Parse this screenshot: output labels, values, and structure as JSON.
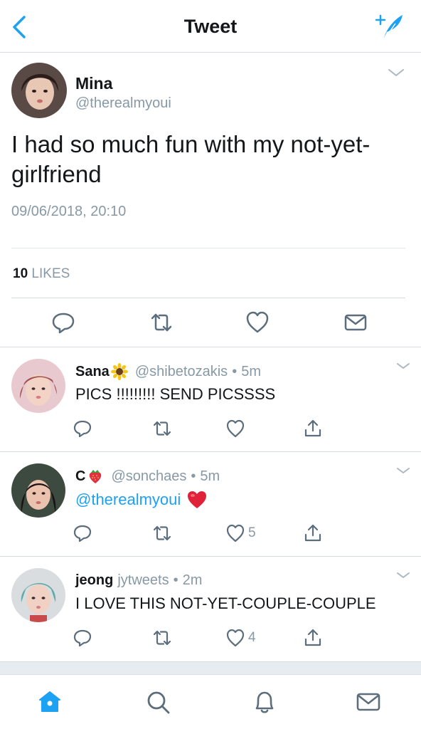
{
  "header": {
    "title": "Tweet",
    "back_icon": "chevron-left-icon",
    "compose_icon": "compose-feather-icon",
    "accent": "#1da1f2"
  },
  "tweet": {
    "author_name": "Mina",
    "author_handle": "@therealmyoui",
    "text": "I had so much fun with my not-yet-girlfriend",
    "date": "09/06/2018, 20:10",
    "likes_count": "10",
    "likes_label": "LIKES",
    "actions": [
      "reply-icon",
      "retweet-icon",
      "like-icon",
      "message-icon"
    ]
  },
  "replies": [
    {
      "name": "Sana",
      "emoji": "sunflower-emoji",
      "handle": "@shibetozakis",
      "sep": "•",
      "time": "5m",
      "text": "PICS !!!!!!!!! SEND PICSSSS",
      "mention": "",
      "like_count": ""
    },
    {
      "name": "C",
      "emoji": "strawberry-emoji",
      "handle": "@sonchaes",
      "sep": "•",
      "time": "5m",
      "text": "",
      "mention": "@therealmyoui",
      "like_count": "5"
    },
    {
      "name": "jeong",
      "emoji": "",
      "handle": "jytweets",
      "sep": "•",
      "time": "2m",
      "text": "I LOVE THIS NOT-YET-COUPLE-COUPLE",
      "mention": "",
      "like_count": "4"
    }
  ],
  "tabbar": {
    "items": [
      "home-icon",
      "search-icon",
      "notifications-icon",
      "messages-icon"
    ],
    "active": "home-icon"
  },
  "colors": {
    "secondary_text": "#8899a6",
    "divider": "#d8dde2",
    "heart_red": "#e0245e"
  }
}
